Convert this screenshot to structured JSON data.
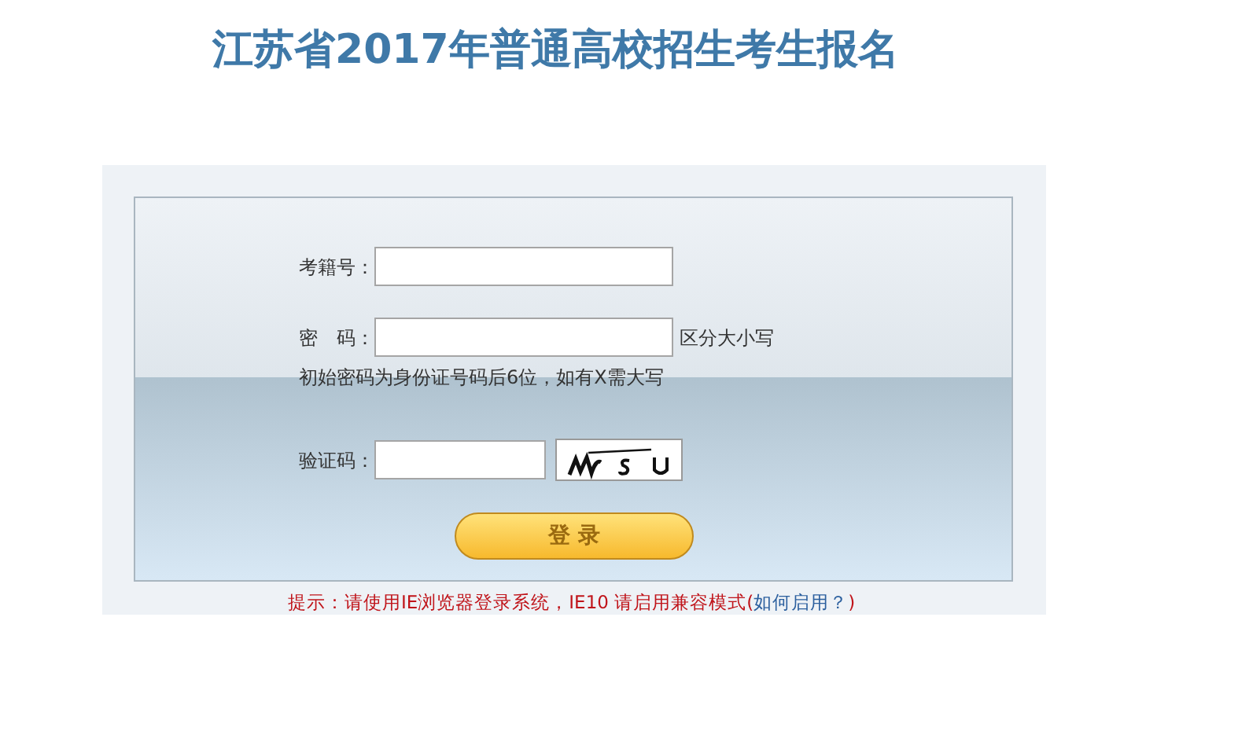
{
  "title": "江苏省2017年普通高校招生考生报名",
  "form": {
    "fields": [
      {
        "kind": "text",
        "label": "考籍号："
      },
      {
        "kind": "password",
        "label": "密　码：",
        "note": "区分大小写",
        "hint": "初始密码为身份证号码后6位，如有X需大写"
      },
      {
        "kind": "captcha",
        "label": "验证码："
      }
    ],
    "submit": "登 录"
  },
  "tip": {
    "text": "提示：请使用IE浏览器登录系统，IE10 请启用兼容模式(",
    "link": "如何启用？",
    "after": ")"
  }
}
